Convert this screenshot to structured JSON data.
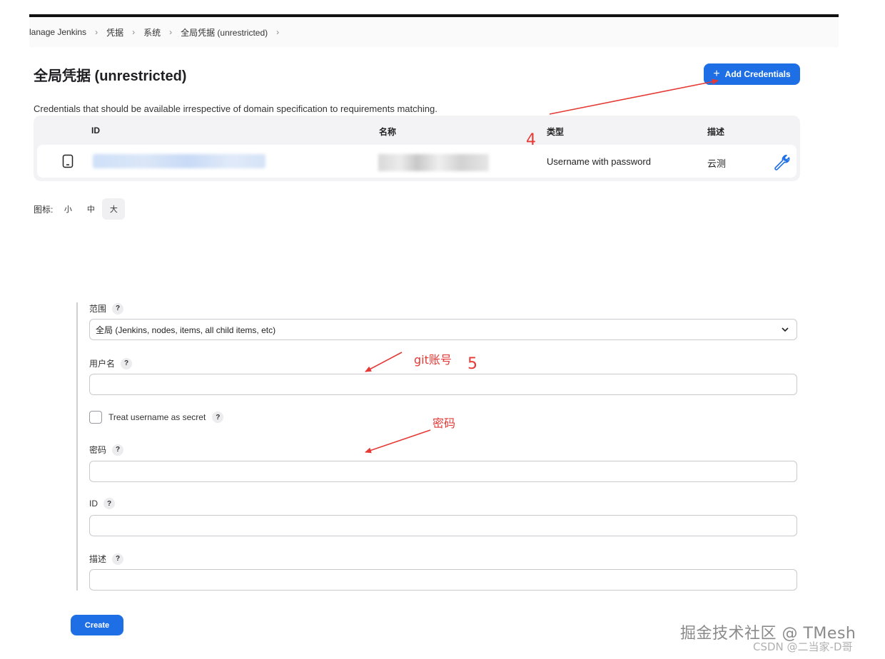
{
  "breadcrumb": [
    "lanage Jenkins",
    "凭据",
    "系统",
    "全局凭据 (unrestricted)"
  ],
  "page": {
    "title": "全局凭据 (unrestricted)",
    "add_button": "Add Credentials",
    "description": "Credentials that should be available irrespective of domain specification to requirements matching."
  },
  "table": {
    "headers": {
      "id": "ID",
      "name": "名称",
      "type": "类型",
      "description": "描述"
    },
    "rows": [
      {
        "id": "",
        "name": "",
        "type": "Username with password",
        "description": "云测"
      }
    ]
  },
  "icon_size": {
    "label": "图标:",
    "options": [
      "小",
      "中",
      "大"
    ],
    "selected": "大"
  },
  "form": {
    "scope": {
      "label": "范围",
      "value": "全局 (Jenkins, nodes, items, all child items, etc)"
    },
    "username": {
      "label": "用户名",
      "value": ""
    },
    "username_secret": {
      "label": "Treat username as secret",
      "checked": false
    },
    "password": {
      "label": "密码",
      "value": ""
    },
    "id": {
      "label": "ID",
      "value": ""
    },
    "description": {
      "label": "描述",
      "value": ""
    },
    "help_glyph": "?",
    "submit": "Create"
  },
  "annotations": {
    "step4": "4",
    "step5": "5",
    "git_account": "git账号",
    "password_note": "密码"
  },
  "watermark": {
    "primary": "掘金技术社区 @ TMesh",
    "secondary": "CSDN @二当家-D哥"
  },
  "colors": {
    "accent": "#1e6fe6",
    "annotation": "#e53935"
  }
}
